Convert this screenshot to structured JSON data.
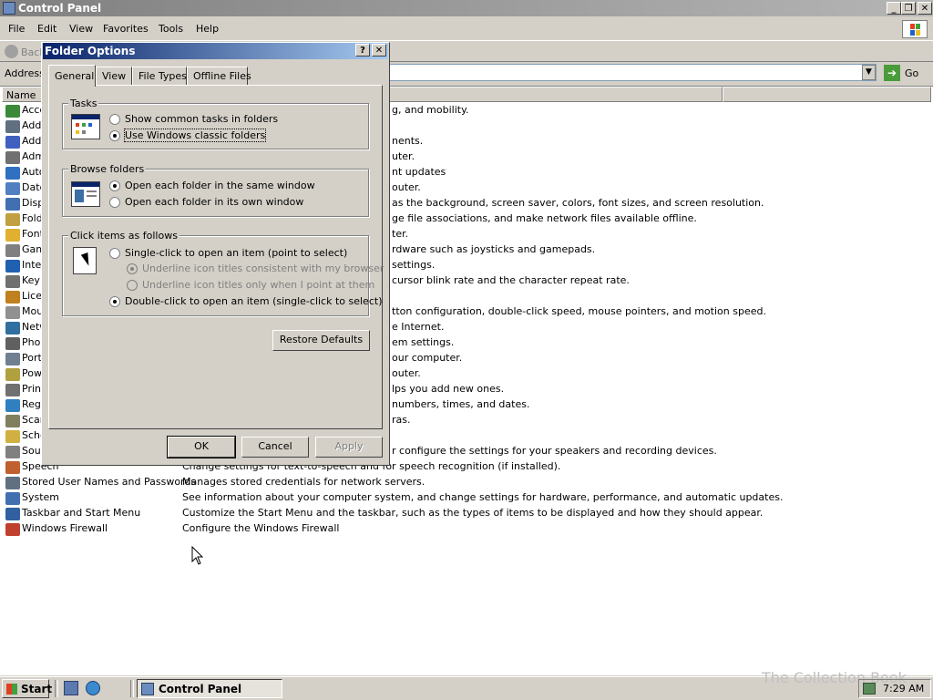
{
  "window": {
    "title": "Control Panel"
  },
  "menu": [
    "File",
    "Edit",
    "View",
    "Favorites",
    "Tools",
    "Help"
  ],
  "toolbar": {
    "back_label": "Back"
  },
  "address": {
    "label": "Address",
    "go_label": "Go"
  },
  "list": {
    "header_name": "Name",
    "rows": [
      {
        "name": "Acce",
        "desc": "g, and mobility.",
        "color": "#3a8a3a"
      },
      {
        "name": "Add",
        "desc": "",
        "color": "#607080"
      },
      {
        "name": "Add",
        "desc": "nents.",
        "color": "#4060c0"
      },
      {
        "name": "Adm",
        "desc": "uter.",
        "color": "#707070"
      },
      {
        "name": "Auto",
        "desc": "nt updates",
        "color": "#3070c0"
      },
      {
        "name": "Date",
        "desc": "outer.",
        "color": "#5080c0"
      },
      {
        "name": "Disp",
        "desc": "as the background, screen saver, colors, font sizes, and screen resolution.",
        "color": "#4070b0"
      },
      {
        "name": "Fold",
        "desc": "ge file associations, and make network files available offline.",
        "color": "#c0a040"
      },
      {
        "name": "Font",
        "desc": "ter.",
        "color": "#e0b030"
      },
      {
        "name": "Gam",
        "desc": "rdware such as joysticks and gamepads.",
        "color": "#808080"
      },
      {
        "name": "Inte",
        "desc": "settings.",
        "color": "#2060b0"
      },
      {
        "name": "Keyb",
        "desc": "cursor blink rate and the character repeat rate.",
        "color": "#707070"
      },
      {
        "name": "Licen",
        "desc": "",
        "color": "#c08020"
      },
      {
        "name": "Mou",
        "desc": "tton configuration, double-click speed, mouse pointers, and motion speed.",
        "color": "#909090"
      },
      {
        "name": "Netw",
        "desc": "e Internet.",
        "color": "#3070a0"
      },
      {
        "name": "Phon",
        "desc": "em settings.",
        "color": "#606060"
      },
      {
        "name": "Port",
        "desc": "our computer.",
        "color": "#708090"
      },
      {
        "name": "Pow",
        "desc": "outer.",
        "color": "#b0a040"
      },
      {
        "name": "Print",
        "desc": "lps you add new ones.",
        "color": "#707070"
      },
      {
        "name": "Regi",
        "desc": "numbers, times, and dates.",
        "color": "#3080c0"
      },
      {
        "name": "Scan",
        "desc": "ras.",
        "color": "#808060"
      },
      {
        "name": "Sche",
        "desc": "",
        "color": "#d0b040"
      },
      {
        "name": "Soun",
        "desc": "r configure the settings for your speakers and recording devices.",
        "color": "#808080"
      },
      {
        "name": "Speech",
        "desc": "Change settings for text-to-speech and for speech recognition (if installed).",
        "color": "#c06030"
      },
      {
        "name": "Stored User Names and Passwords",
        "desc": "Manages stored credentials for network servers.",
        "color": "#607080"
      },
      {
        "name": "System",
        "desc": "See information about your computer system, and change settings for hardware, performance, and automatic updates.",
        "color": "#4070b0"
      },
      {
        "name": "Taskbar and Start Menu",
        "desc": "Customize the Start Menu and the taskbar, such as the types of items to be displayed and how they should appear.",
        "color": "#3060a0"
      },
      {
        "name": "Windows Firewall",
        "desc": "Configure the Windows Firewall",
        "color": "#c04030"
      }
    ]
  },
  "dialog": {
    "title": "Folder Options",
    "tabs": [
      "General",
      "View",
      "File Types",
      "Offline Files"
    ],
    "tasks": {
      "label": "Tasks",
      "opt1": "Show common tasks in folders",
      "opt2": "Use Windows classic folders"
    },
    "browse": {
      "label": "Browse folders",
      "opt1": "Open each folder in the same window",
      "opt2": "Open each folder in its own window"
    },
    "click": {
      "label": "Click items as follows",
      "opt1": "Single-click to open an item (point to select)",
      "sub1": "Underline icon titles consistent with my browser",
      "sub2": "Underline icon titles only when I point at them",
      "opt2": "Double-click to open an item (single-click to select)"
    },
    "restore_label": "Restore Defaults",
    "ok_label": "OK",
    "cancel_label": "Cancel",
    "apply_label": "Apply"
  },
  "taskbar": {
    "start_label": "Start",
    "task_label": "Control Panel",
    "clock": "7:29 AM",
    "watermark": "The Collection Book"
  }
}
